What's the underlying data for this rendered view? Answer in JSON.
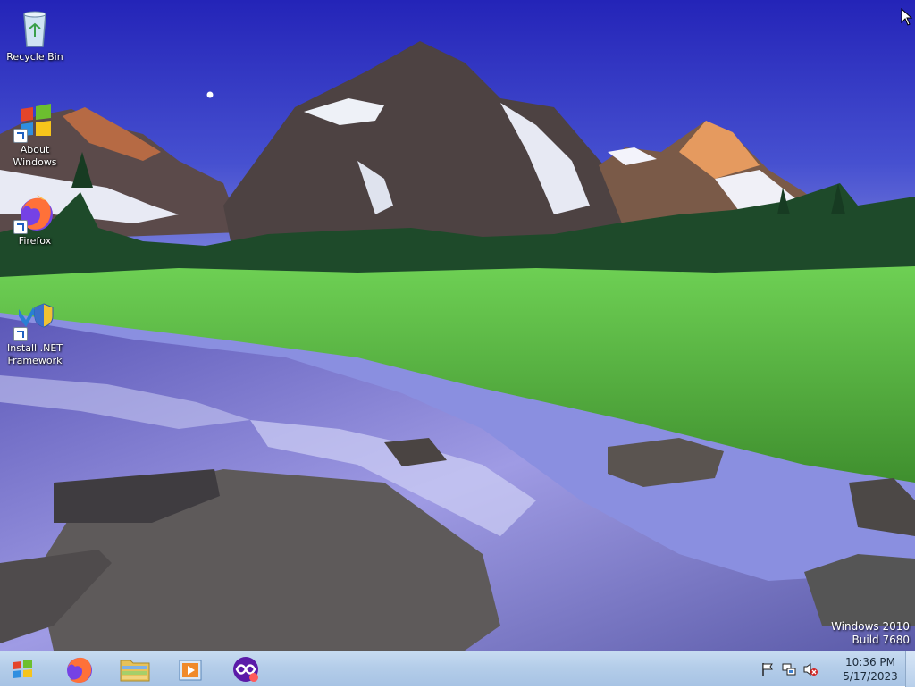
{
  "desktop": {
    "icons": [
      {
        "label": "Recycle Bin",
        "icon": "recycle-bin-icon"
      },
      {
        "label": "About\nWindows",
        "icon": "windows-logo-icon"
      },
      {
        "label": "Firefox",
        "icon": "firefox-icon"
      },
      {
        "label": "Install .NET\nFramework",
        "icon": "dotnet-installer-icon"
      }
    ]
  },
  "watermark": {
    "line1": "Windows 2010",
    "line2": "Build 7680"
  },
  "taskbar": {
    "start_icon": "windows-start-orb-icon",
    "pinned": [
      {
        "name": "firefox",
        "icon": "firefox-icon"
      },
      {
        "name": "file-explorer",
        "icon": "folder-icon"
      },
      {
        "name": "media-player",
        "icon": "media-player-icon"
      },
      {
        "name": "app",
        "icon": "purple-app-icon"
      }
    ],
    "tray": {
      "icons": [
        "action-center-flag-icon",
        "network-icon",
        "volume-muted-icon"
      ],
      "time": "10:36 PM",
      "date": "5/17/2023"
    }
  },
  "colors": {
    "taskbar": "#b4cde9",
    "sky": "#3a3fc4"
  }
}
